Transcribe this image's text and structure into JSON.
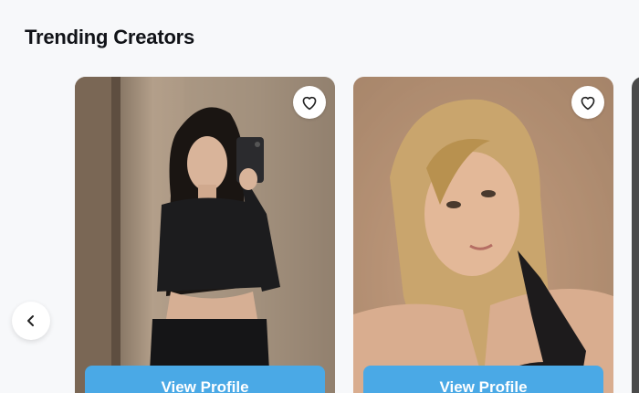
{
  "section": {
    "title": "Trending Creators"
  },
  "cards": [
    {
      "button_label": "View Profile",
      "favorite_icon": "heart-outline-icon"
    },
    {
      "button_label": "View Profile",
      "favorite_icon": "heart-outline-icon"
    }
  ],
  "navigation": {
    "prev_icon": "chevron-left-icon"
  },
  "colors": {
    "accent": "#4aa9e6",
    "background": "#f7f8fa",
    "title": "#111318"
  }
}
